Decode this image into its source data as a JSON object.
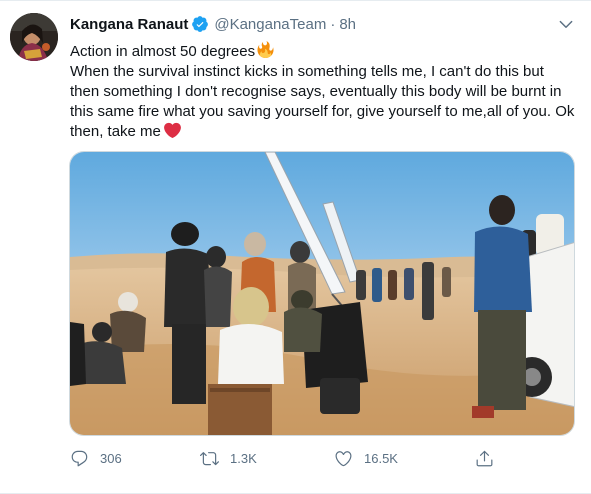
{
  "tweet": {
    "author_name": "Kangana Ranaut",
    "handle": "@KanganaTeam",
    "separator": "·",
    "timestamp": "8h",
    "text_lines": [
      "Action in almost 50 degrees",
      "When the survival instinct kicks in something tells me, I can't do this but",
      "then something I don't recognise says, eventually this body will be burnt in",
      "this same fire what you saving yourself for, give yourself to me,all of you. Ok",
      "then, take me"
    ],
    "emojis": {
      "line0_end": "fire-emoji",
      "line4_end": "red-heart-emoji"
    },
    "icons": {
      "verified": "verified-badge-icon",
      "more": "chevron-down-icon",
      "reply": "reply-icon",
      "retweet": "retweet-icon",
      "like": "heart-icon",
      "share": "share-icon"
    },
    "media": {
      "kind": "photo",
      "scene": "film crew on desert sand dunes under a blue sky"
    },
    "stats": {
      "replies": "306",
      "retweets": "1.3K",
      "likes": "16.5K"
    },
    "colors": {
      "text": "#0f1419",
      "secondary": "#5b7083",
      "verified": "#1da1f2",
      "border": "#e6ecf0"
    }
  }
}
